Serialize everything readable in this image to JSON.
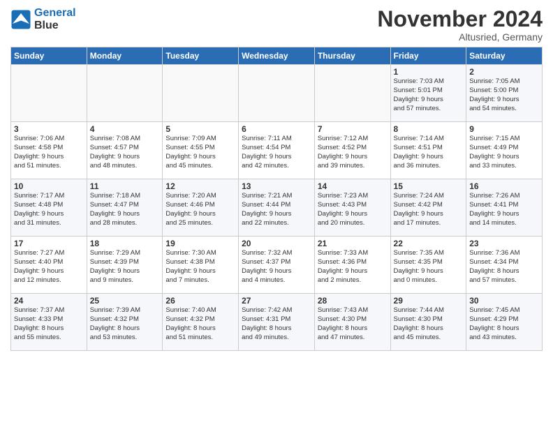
{
  "header": {
    "logo_line1": "General",
    "logo_line2": "Blue",
    "title": "November 2024",
    "location": "Altusried, Germany"
  },
  "days_of_week": [
    "Sunday",
    "Monday",
    "Tuesday",
    "Wednesday",
    "Thursday",
    "Friday",
    "Saturday"
  ],
  "weeks": [
    {
      "days": [
        {
          "num": "",
          "info": ""
        },
        {
          "num": "",
          "info": ""
        },
        {
          "num": "",
          "info": ""
        },
        {
          "num": "",
          "info": ""
        },
        {
          "num": "",
          "info": ""
        },
        {
          "num": "1",
          "info": "Sunrise: 7:03 AM\nSunset: 5:01 PM\nDaylight: 9 hours\nand 57 minutes."
        },
        {
          "num": "2",
          "info": "Sunrise: 7:05 AM\nSunset: 5:00 PM\nDaylight: 9 hours\nand 54 minutes."
        }
      ]
    },
    {
      "days": [
        {
          "num": "3",
          "info": "Sunrise: 7:06 AM\nSunset: 4:58 PM\nDaylight: 9 hours\nand 51 minutes."
        },
        {
          "num": "4",
          "info": "Sunrise: 7:08 AM\nSunset: 4:57 PM\nDaylight: 9 hours\nand 48 minutes."
        },
        {
          "num": "5",
          "info": "Sunrise: 7:09 AM\nSunset: 4:55 PM\nDaylight: 9 hours\nand 45 minutes."
        },
        {
          "num": "6",
          "info": "Sunrise: 7:11 AM\nSunset: 4:54 PM\nDaylight: 9 hours\nand 42 minutes."
        },
        {
          "num": "7",
          "info": "Sunrise: 7:12 AM\nSunset: 4:52 PM\nDaylight: 9 hours\nand 39 minutes."
        },
        {
          "num": "8",
          "info": "Sunrise: 7:14 AM\nSunset: 4:51 PM\nDaylight: 9 hours\nand 36 minutes."
        },
        {
          "num": "9",
          "info": "Sunrise: 7:15 AM\nSunset: 4:49 PM\nDaylight: 9 hours\nand 33 minutes."
        }
      ]
    },
    {
      "days": [
        {
          "num": "10",
          "info": "Sunrise: 7:17 AM\nSunset: 4:48 PM\nDaylight: 9 hours\nand 31 minutes."
        },
        {
          "num": "11",
          "info": "Sunrise: 7:18 AM\nSunset: 4:47 PM\nDaylight: 9 hours\nand 28 minutes."
        },
        {
          "num": "12",
          "info": "Sunrise: 7:20 AM\nSunset: 4:46 PM\nDaylight: 9 hours\nand 25 minutes."
        },
        {
          "num": "13",
          "info": "Sunrise: 7:21 AM\nSunset: 4:44 PM\nDaylight: 9 hours\nand 22 minutes."
        },
        {
          "num": "14",
          "info": "Sunrise: 7:23 AM\nSunset: 4:43 PM\nDaylight: 9 hours\nand 20 minutes."
        },
        {
          "num": "15",
          "info": "Sunrise: 7:24 AM\nSunset: 4:42 PM\nDaylight: 9 hours\nand 17 minutes."
        },
        {
          "num": "16",
          "info": "Sunrise: 7:26 AM\nSunset: 4:41 PM\nDaylight: 9 hours\nand 14 minutes."
        }
      ]
    },
    {
      "days": [
        {
          "num": "17",
          "info": "Sunrise: 7:27 AM\nSunset: 4:40 PM\nDaylight: 9 hours\nand 12 minutes."
        },
        {
          "num": "18",
          "info": "Sunrise: 7:29 AM\nSunset: 4:39 PM\nDaylight: 9 hours\nand 9 minutes."
        },
        {
          "num": "19",
          "info": "Sunrise: 7:30 AM\nSunset: 4:38 PM\nDaylight: 9 hours\nand 7 minutes."
        },
        {
          "num": "20",
          "info": "Sunrise: 7:32 AM\nSunset: 4:37 PM\nDaylight: 9 hours\nand 4 minutes."
        },
        {
          "num": "21",
          "info": "Sunrise: 7:33 AM\nSunset: 4:36 PM\nDaylight: 9 hours\nand 2 minutes."
        },
        {
          "num": "22",
          "info": "Sunrise: 7:35 AM\nSunset: 4:35 PM\nDaylight: 9 hours\nand 0 minutes."
        },
        {
          "num": "23",
          "info": "Sunrise: 7:36 AM\nSunset: 4:34 PM\nDaylight: 8 hours\nand 57 minutes."
        }
      ]
    },
    {
      "days": [
        {
          "num": "24",
          "info": "Sunrise: 7:37 AM\nSunset: 4:33 PM\nDaylight: 8 hours\nand 55 minutes."
        },
        {
          "num": "25",
          "info": "Sunrise: 7:39 AM\nSunset: 4:32 PM\nDaylight: 8 hours\nand 53 minutes."
        },
        {
          "num": "26",
          "info": "Sunrise: 7:40 AM\nSunset: 4:32 PM\nDaylight: 8 hours\nand 51 minutes."
        },
        {
          "num": "27",
          "info": "Sunrise: 7:42 AM\nSunset: 4:31 PM\nDaylight: 8 hours\nand 49 minutes."
        },
        {
          "num": "28",
          "info": "Sunrise: 7:43 AM\nSunset: 4:30 PM\nDaylight: 8 hours\nand 47 minutes."
        },
        {
          "num": "29",
          "info": "Sunrise: 7:44 AM\nSunset: 4:30 PM\nDaylight: 8 hours\nand 45 minutes."
        },
        {
          "num": "30",
          "info": "Sunrise: 7:45 AM\nSunset: 4:29 PM\nDaylight: 8 hours\nand 43 minutes."
        }
      ]
    }
  ]
}
